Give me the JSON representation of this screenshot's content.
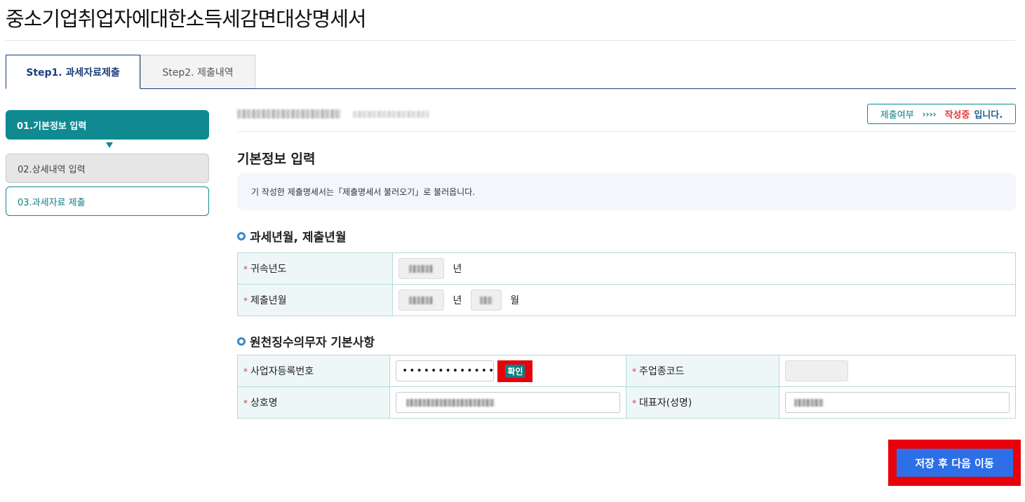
{
  "page": {
    "title": "중소기업취업자에대한소득세감면대상명세서"
  },
  "tabs": [
    {
      "label": "Step1. 과세자료제출"
    },
    {
      "label": "Step2. 제출내역"
    }
  ],
  "sidebar": {
    "steps": [
      {
        "label": "01.기본정보 입력"
      },
      {
        "label": "02.상세내역 입력"
      },
      {
        "label": "03.과세자료 제출"
      }
    ]
  },
  "status": {
    "label": "제출여부",
    "arrows": "››››",
    "state": "작성중",
    "suffix": "입니다."
  },
  "section": {
    "title": "기본정보 입력",
    "notice": "기 작성한 제출명세서는「제출명세서 불러오기」로 불러옵니다."
  },
  "period": {
    "title": "과세년월, 제출년월",
    "rows": [
      {
        "label": "귀속년도",
        "unit1": "년"
      },
      {
        "label": "제출년월",
        "unit1": "년",
        "unit2": "월"
      }
    ]
  },
  "withholder": {
    "title": "원천징수의무자 기본사항",
    "biz_no_label": "사업자등록번호",
    "biz_no_value": "•••••••••••••",
    "confirm_label": "확인",
    "industry_code_label": "주업종코드",
    "company_name_label": "상호명",
    "representative_label": "대표자(성명)"
  },
  "footer": {
    "next_label": "저장 후 다음 이동"
  },
  "colors": {
    "accent": "#0f8a91",
    "primary_button": "#2d6fe6",
    "required": "#e03a3a",
    "highlight": "#e8000b"
  }
}
